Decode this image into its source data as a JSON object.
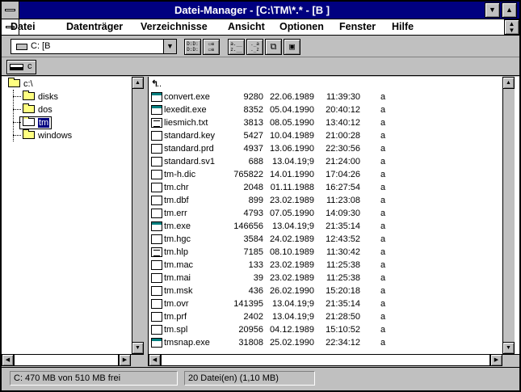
{
  "window": {
    "title": "Datei-Manager - [C:\\TM\\*.* - [B ]"
  },
  "menu": {
    "items": [
      {
        "label": "Datei"
      },
      {
        "label": "Datenträger"
      },
      {
        "label": "Verzeichnisse"
      },
      {
        "label": "Ansicht"
      },
      {
        "label": "Optionen"
      },
      {
        "label": "Fenster"
      },
      {
        "label": "Hilfe"
      }
    ]
  },
  "toolbar": {
    "drive_select_value": "C: [B",
    "buttons": [
      {
        "icon": "view-names-icon",
        "glyph": "D:D: D:D:"
      },
      {
        "icon": "view-details-icon",
        "glyph": "≡ ≡"
      },
      {
        "icon": "sort-by-name-icon",
        "glyph": "a.__ z.__"
      },
      {
        "icon": "sort-by-type-icon",
        "glyph": "._a ._z"
      },
      {
        "icon": "new-window-icon",
        "glyph": "◻◻"
      },
      {
        "icon": "tile-icon",
        "glyph": "▣"
      }
    ]
  },
  "drivebar": {
    "drive_label": "c"
  },
  "tree": {
    "root": "c:\\",
    "folders": [
      "disks",
      "dos",
      "tm",
      "windows"
    ],
    "selected": "tm"
  },
  "files": {
    "parent_label": "..",
    "rows": [
      {
        "name": "convert.exe",
        "size": "9280",
        "date": "22.06.1989",
        "time": "11:39:30",
        "attr": "a",
        "type": "exe"
      },
      {
        "name": "lexedit.exe",
        "size": "8352",
        "date": "05.04.1990",
        "time": "20:40:12",
        "attr": "a",
        "type": "exe"
      },
      {
        "name": "liesmich.txt",
        "size": "3813",
        "date": "08.05.1990",
        "time": "13:40:12",
        "attr": "a",
        "type": "txt"
      },
      {
        "name": "standard.key",
        "size": "5427",
        "date": "10.04.1989",
        "time": "21:00:28",
        "attr": "a",
        "type": "doc"
      },
      {
        "name": "standard.prd",
        "size": "4937",
        "date": "13.06.1990",
        "time": "22:30:56",
        "attr": "a",
        "type": "doc"
      },
      {
        "name": "standard.sv1",
        "size": "688",
        "date": "13.04.19;9",
        "time": "21:24:00",
        "attr": "a",
        "type": "doc"
      },
      {
        "name": "tm-h.dic",
        "size": "765822",
        "date": "14.01.1990",
        "time": "17:04:26",
        "attr": "a",
        "type": "doc"
      },
      {
        "name": "tm.chr",
        "size": "2048",
        "date": "01.11.1988",
        "time": "16:27:54",
        "attr": "a",
        "type": "doc"
      },
      {
        "name": "tm.dbf",
        "size": "899",
        "date": "23.02.1989",
        "time": "11:23:08",
        "attr": "a",
        "type": "doc"
      },
      {
        "name": "tm.err",
        "size": "4793",
        "date": "07.05.1990",
        "time": "14:09:30",
        "attr": "a",
        "type": "doc"
      },
      {
        "name": "tm.exe",
        "size": "146656",
        "date": "13.04.19;9",
        "time": "21:35:14",
        "attr": "a",
        "type": "exe"
      },
      {
        "name": "tm.hgc",
        "size": "3584",
        "date": "24.02.1989",
        "time": "12:43:52",
        "attr": "a",
        "type": "doc"
      },
      {
        "name": "tm.hlp",
        "size": "7185",
        "date": "08.10.1989",
        "time": "11:30:42",
        "attr": "a",
        "type": "txt"
      },
      {
        "name": "tm.mac",
        "size": "133",
        "date": "23.02.1989",
        "time": "11:25:38",
        "attr": "a",
        "type": "doc"
      },
      {
        "name": "tm.mai",
        "size": "39",
        "date": "23.02.1989",
        "time": "11:25:38",
        "attr": "a",
        "type": "doc"
      },
      {
        "name": "tm.msk",
        "size": "436",
        "date": "26.02.1990",
        "time": "15:20:18",
        "attr": "a",
        "type": "doc"
      },
      {
        "name": "tm.ovr",
        "size": "141395",
        "date": "13.04.19;9",
        "time": "21:35:14",
        "attr": "a",
        "type": "doc"
      },
      {
        "name": "tm.prf",
        "size": "2402",
        "date": "13.04.19;9",
        "time": "21:28:50",
        "attr": "a",
        "type": "doc"
      },
      {
        "name": "tm.spl",
        "size": "20956",
        "date": "04.12.1989",
        "time": "15:10:52",
        "attr": "a",
        "type": "doc"
      },
      {
        "name": "tmsnap.exe",
        "size": "31808",
        "date": "25.02.1990",
        "time": "22:34:12",
        "attr": "a",
        "type": "exe"
      }
    ]
  },
  "status": {
    "free_space": "C: 470 MB von 510 MB frei",
    "file_count": "20 Datei(en) (1,10 MB)"
  }
}
